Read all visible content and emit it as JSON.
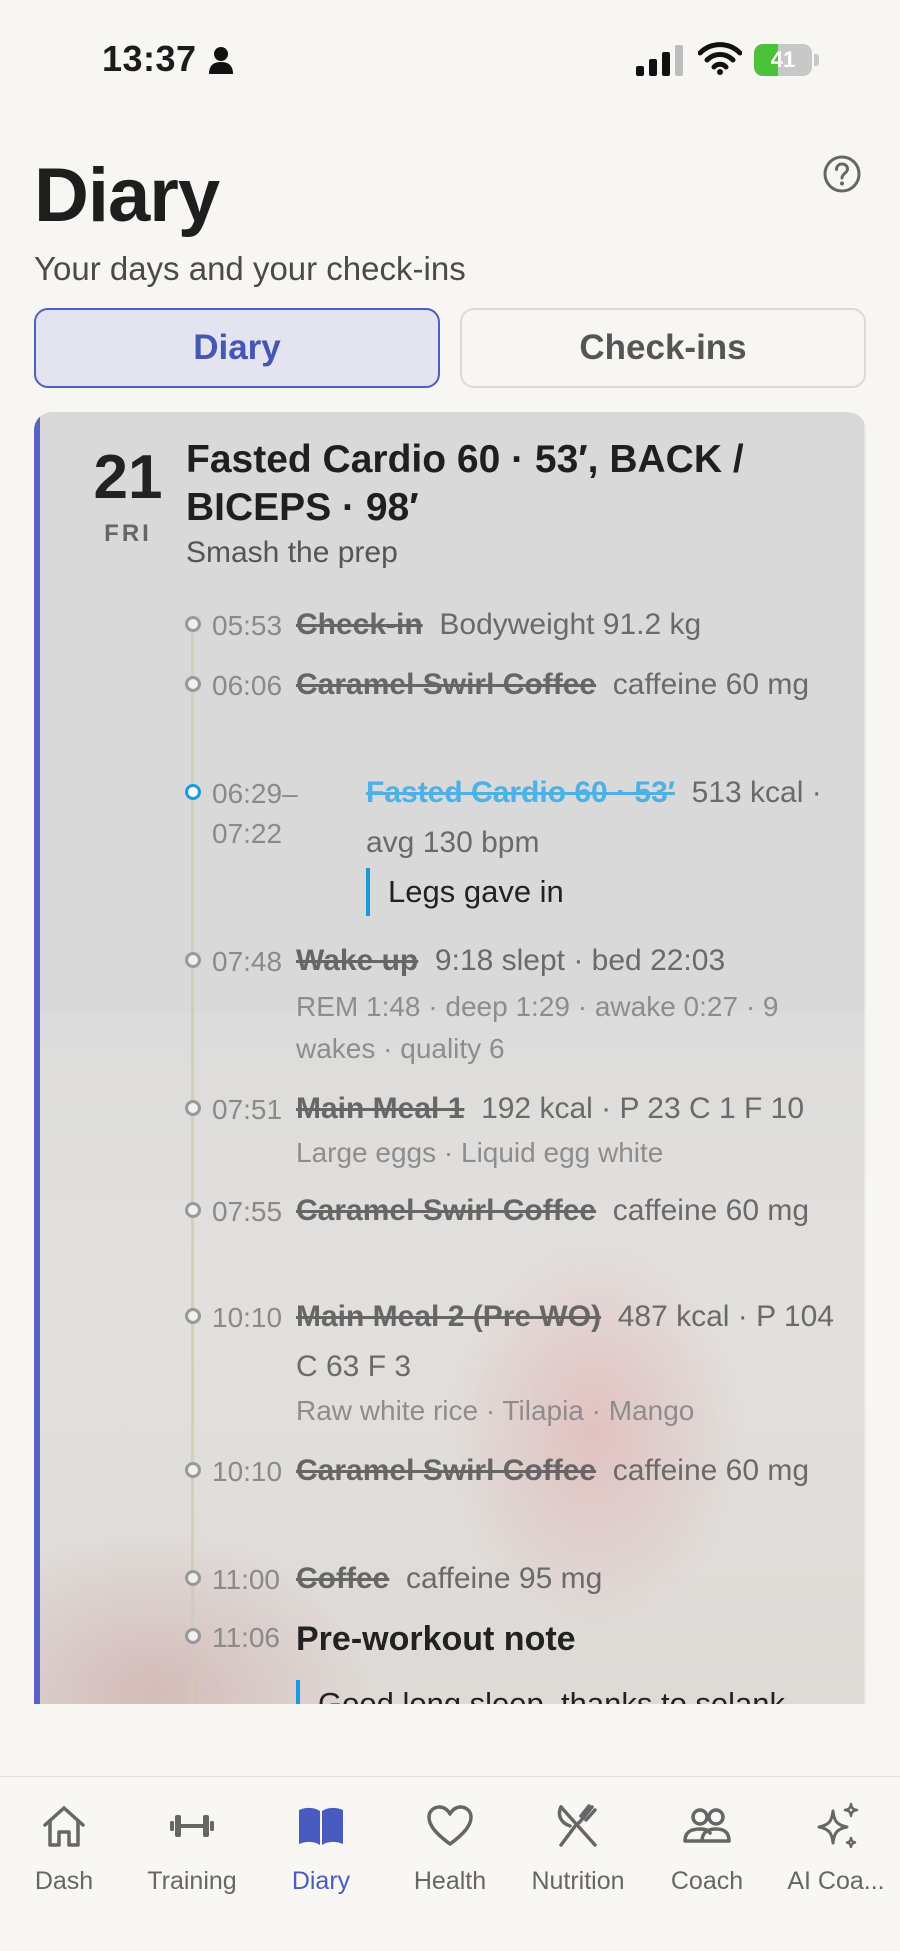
{
  "status_bar": {
    "time": "13:37",
    "battery": "41",
    "battery_level": 0.41
  },
  "header": {
    "title": "Diary",
    "subtitle": "Your days and your check-ins"
  },
  "tabs": [
    {
      "label": "Diary",
      "selected": true
    },
    {
      "label": "Check-ins",
      "selected": false
    }
  ],
  "day": {
    "number": "21",
    "weekday": "FRI",
    "title": "Fasted Cardio 60 · 53′, BACK / BICEPS · 98′",
    "subtitle": "Smash the prep"
  },
  "entries": [
    {
      "time": "05:53",
      "title": "Check-in",
      "detail": "Bodyweight 91.2 kg"
    },
    {
      "time": "06:06",
      "title": "Caramel Swirl Coffee",
      "detail": "caffeine 60 mg"
    },
    {
      "time": "06:29–07:22",
      "title": "Fasted Cardio 60 · 53′",
      "detail": "513 kcal · avg 130 bpm",
      "note": "Legs gave in"
    },
    {
      "time": "07:48",
      "title": "Wake up",
      "detail": "9:18 slept · bed 22:03",
      "sub": "REM 1:48 · deep 1:29 · awake 0:27 · 9 wakes · quality 6"
    },
    {
      "time": "07:51",
      "title": "Main Meal 1",
      "detail": "192 kcal · P 23 C 1 F 10",
      "sub": "Large eggs · Liquid egg white"
    },
    {
      "time": "07:55",
      "title": "Caramel Swirl Coffee",
      "detail": "caffeine 60 mg"
    },
    {
      "time": "10:10",
      "title": "Main Meal 2 (Pre WO)",
      "detail": "487 kcal · P 104 C 63 F 3",
      "sub": "Raw white rice · Tilapia · Mango"
    },
    {
      "time": "10:10",
      "title": "Caramel Swirl Coffee",
      "detail": "caffeine 60 mg"
    },
    {
      "time": "11:00",
      "title": "Coffee",
      "detail": "caffeine 95 mg"
    },
    {
      "time": "11:06",
      "title": "Pre-workout note",
      "note": "Good long sleep, thanks to selank"
    }
  ],
  "tabbar": [
    {
      "label": "Dash",
      "icon": "house-icon"
    },
    {
      "label": "Training",
      "icon": "dumbbell-icon"
    },
    {
      "label": "Diary",
      "icon": "book-icon",
      "active": true
    },
    {
      "label": "Health",
      "icon": "heart-icon"
    },
    {
      "label": "Nutrition",
      "icon": "utensils-icon"
    },
    {
      "label": "Coach",
      "icon": "people-icon"
    },
    {
      "label": "AI Coa...",
      "icon": "sparkles-icon"
    }
  ],
  "colors": {
    "accent": "#4f5fbd",
    "blue": "#1a9bde",
    "battery": "#4cc23a"
  }
}
